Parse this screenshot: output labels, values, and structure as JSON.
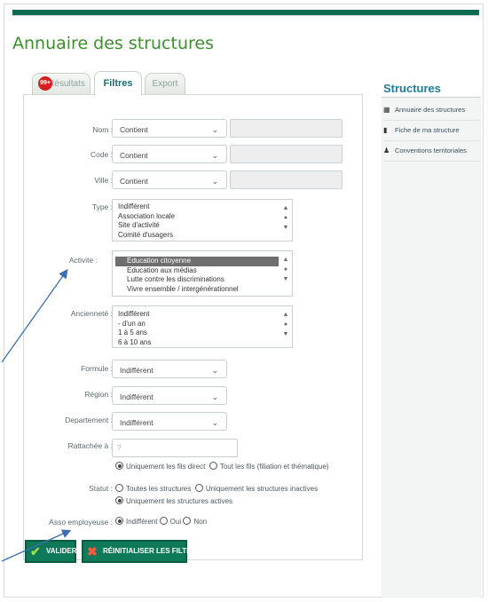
{
  "page_title": "Annuaire des structures",
  "tabs": {
    "results": {
      "label": "Résultats",
      "badge": "99+"
    },
    "filtres": {
      "label": "Filtres"
    },
    "export": {
      "label": "Export"
    }
  },
  "form": {
    "nom": {
      "label": "Nom :",
      "mode": "Contient",
      "value": ""
    },
    "code": {
      "label": "Code :",
      "mode": "Contient",
      "value": ""
    },
    "ville": {
      "label": "Ville :",
      "mode": "Contient",
      "value": ""
    },
    "type": {
      "label": "Type :",
      "options": [
        "Indifférent",
        "Association locale",
        "Site d'activité",
        "Comité d'usagers"
      ]
    },
    "activite": {
      "label": "Activite :",
      "options": [
        "Education citoyenne",
        "Education aux médias",
        "Lutte contre les discriminations",
        "Vivre ensemble / intergénérationnel"
      ],
      "selected": "Education citoyenne"
    },
    "anciennete": {
      "label": "Ancienneté :",
      "options": [
        "Indifférent",
        "- d'un an",
        "1 à 5 ans",
        "6 à 10 ans"
      ]
    },
    "formule": {
      "label": "Formule :",
      "value": "Indifférent"
    },
    "region": {
      "label": "Région :",
      "value": "Indifférent"
    },
    "departement": {
      "label": "Departement :",
      "value": "Indifférent"
    },
    "rattachee": {
      "label": "Rattachée à :",
      "placeholder": "?",
      "options": [
        "Uniquement les fils direct",
        "Tout les fils (filiation et thématique)"
      ],
      "selected": 0
    },
    "statut": {
      "label": "Statut :",
      "options": [
        "Toutes les structures",
        "Uniquement les structures inactives",
        "Uniquement les structures actives"
      ],
      "selected": 2
    },
    "asso": {
      "label": "Asso employeuse :",
      "options": [
        "Indifférent",
        "Oui",
        "Non"
      ],
      "selected": 0
    }
  },
  "buttons": {
    "valider": "VALIDER",
    "reinit": "RÉINITIALISER LES FILTRES"
  },
  "sidebar": {
    "title": "Structures",
    "items": [
      {
        "label": "Annuaire des structures",
        "icon": "table-icon"
      },
      {
        "label": "Fiche de ma structure",
        "icon": "document-icon"
      },
      {
        "label": "Conventions territoriales",
        "icon": "person-icon"
      }
    ]
  },
  "colors": {
    "accent": "#0e7a5a",
    "title": "#3d8f2c",
    "sidebar_title": "#1d7f97",
    "arrow": "#3d6fb0"
  }
}
